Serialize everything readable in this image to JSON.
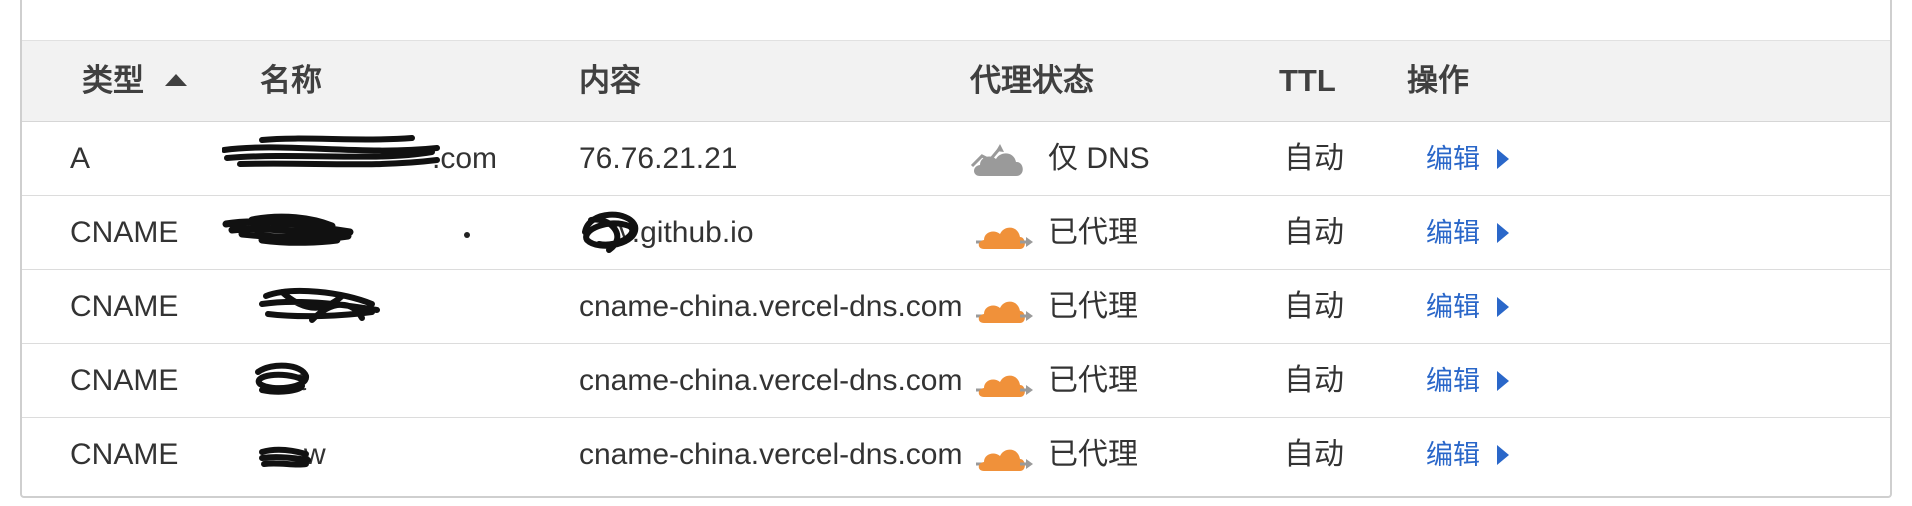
{
  "table": {
    "headers": {
      "type": "类型",
      "name": "名称",
      "content": "内容",
      "proxy": "代理状态",
      "ttl": "TTL",
      "actions": "操作"
    },
    "sort": {
      "column": "type",
      "direction": "ascending",
      "icon": "sort-up-arrow-icon"
    },
    "rows": [
      {
        "type": "A",
        "name": ".com",
        "content": "76.76.21.21",
        "proxy_status": "仅 DNS",
        "proxied": false,
        "proxy_icon": "dns-only-cloud-icon",
        "ttl": "自动",
        "action": "编辑"
      },
      {
        "type": "CNAME",
        "name": "",
        "content": "v.github.io",
        "proxy_status": "已代理",
        "proxied": true,
        "proxy_icon": "proxied-cloud-icon",
        "ttl": "自动",
        "action": "编辑"
      },
      {
        "type": "CNAME",
        "name": "",
        "content": "cname-china.vercel-dns.com",
        "proxy_status": "已代理",
        "proxied": true,
        "proxy_icon": "proxied-cloud-icon",
        "ttl": "自动",
        "action": "编辑"
      },
      {
        "type": "CNAME",
        "name": "t",
        "content": "cname-china.vercel-dns.com",
        "proxy_status": "已代理",
        "proxied": true,
        "proxy_icon": "proxied-cloud-icon",
        "ttl": "自动",
        "action": "编辑"
      },
      {
        "type": "CNAME",
        "name": "w",
        "content": "cname-china.vercel-dns.com",
        "proxy_status": "已代理",
        "proxied": true,
        "proxy_icon": "proxied-cloud-icon",
        "ttl": "自动",
        "action": "编辑"
      }
    ]
  },
  "colors": {
    "proxied_cloud": "#f0913a",
    "dns_only_cloud": "#9a9a9a",
    "link": "#2a67c9",
    "header_bg": "#f2f2f2"
  }
}
